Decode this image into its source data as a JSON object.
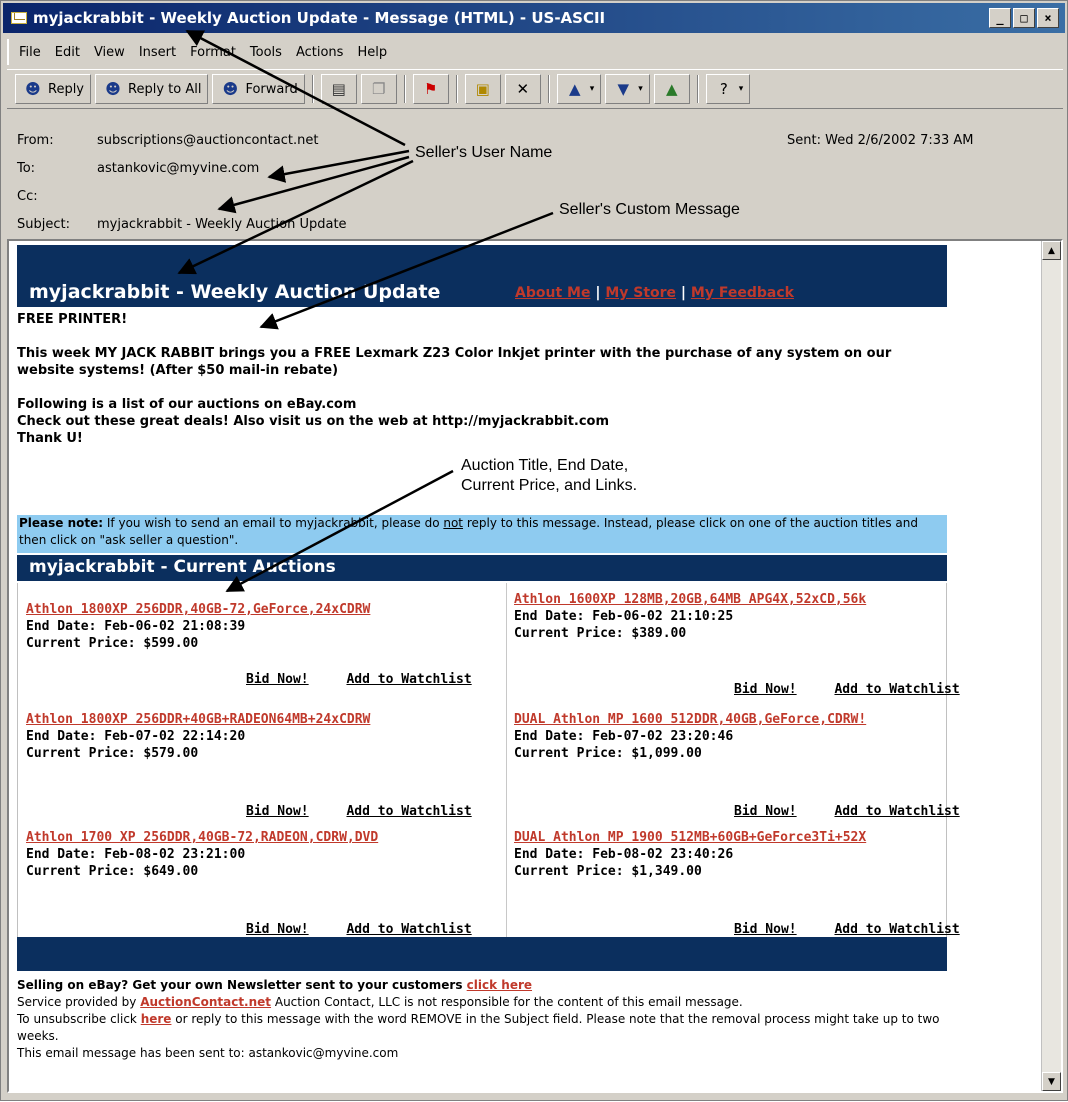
{
  "window": {
    "title": "myjackrabbit - Weekly Auction Update - Message (HTML) - US-ASCII",
    "buttons": [
      "_",
      "□",
      "×"
    ]
  },
  "menu": [
    "File",
    "Edit",
    "View",
    "Insert",
    "Format",
    "Tools",
    "Actions",
    "Help"
  ],
  "toolbar": {
    "reply": "Reply",
    "reply_all": "Reply to All",
    "forward": "Forward"
  },
  "headers": {
    "from_label": "From:",
    "from": "subscriptions@auctioncontact.net",
    "to_label": "To:",
    "to": "astankovic@myvine.com",
    "cc_label": "Cc:",
    "cc": "",
    "subject_label": "Subject:",
    "subject": "myjackrabbit - Weekly Auction Update",
    "sent": "Sent:  Wed 2/6/2002 7:33 AM"
  },
  "annotations": {
    "seller_user_name": "Seller's User Name",
    "seller_custom_message": "Seller's Custom Message",
    "auction_info_line1": "Auction Title, End Date,",
    "auction_info_line2": "Current Price, and Links."
  },
  "email": {
    "hero_title": "myjackrabbit - Weekly Auction Update",
    "links": [
      "About Me",
      "My Store",
      "My Feedback"
    ],
    "free_printer": "FREE PRINTER!",
    "para1": "This week MY JACK RABBIT brings you a FREE Lexmark Z23 Color Inkjet printer with the purchase of any system on our website systems! (After $50 mail-in rebate)",
    "para2a": "Following is a list of our auctions on eBay.com",
    "para2b": "Check out these great deals! Also visit us on the web at http://myjackrabbit.com",
    "para2c": "Thank U!",
    "note_label": "Please note:",
    "note_text_1": " If you wish to send an email to myjackrabbit, please do ",
    "note_not": "not",
    "note_text_2": " reply to this message. Instead, please click on one of the auction titles and then click on \"ask seller a question\".",
    "current_auctions": "myjackrabbit - Current Auctions",
    "bid_now": "Bid Now!",
    "add_watchlist": "Add to Watchlist",
    "auctions": [
      {
        "title": "Athlon 1800XP 256DDR,40GB-72,GeForce,24xCDRW",
        "end": "End Date: Feb-06-02 21:08:39",
        "price": "Current Price: $599.00"
      },
      {
        "title": "Athlon 1600XP 128MB,20GB,64MB APG4X,52xCD,56k",
        "end": "End Date: Feb-06-02 21:10:25",
        "price": "Current Price: $389.00"
      },
      {
        "title": "Athlon 1800XP 256DDR+40GB+RADEON64MB+24xCDRW",
        "end": "End Date: Feb-07-02 22:14:20",
        "price": "Current Price: $579.00"
      },
      {
        "title": "DUAL Athlon MP 1600 512DDR,40GB,GeForce,CDRW!",
        "end": "End Date: Feb-07-02 23:20:46",
        "price": "Current Price: $1,099.00"
      },
      {
        "title": "Athlon 1700 XP 256DDR,40GB-72,RADEON,CDRW,DVD",
        "end": "End Date: Feb-08-02 23:21:00",
        "price": "Current Price: $649.00"
      },
      {
        "title": "DUAL Athlon MP 1900 512MB+60GB+GeForce3Ti+52X",
        "end": "End Date: Feb-08-02 23:40:26",
        "price": "Current Price: $1,349.00"
      }
    ],
    "footer": {
      "selling": "Selling on eBay? Get your own Newsletter sent to your customers ",
      "click_here": "click here",
      "service": "Service provided by ",
      "auctioncontact": "AuctionContact.net",
      "service_rest": " Auction Contact, LLC is not responsible for the content of this email message.",
      "unsub_a": "To unsubscribe click ",
      "here": "here",
      "unsub_b": " or reply to this message with the word REMOVE in the Subject field. Please note that the removal process might take up to two weeks.",
      "sent_to": "This email message has been sent to: astankovic@myvine.com"
    }
  }
}
